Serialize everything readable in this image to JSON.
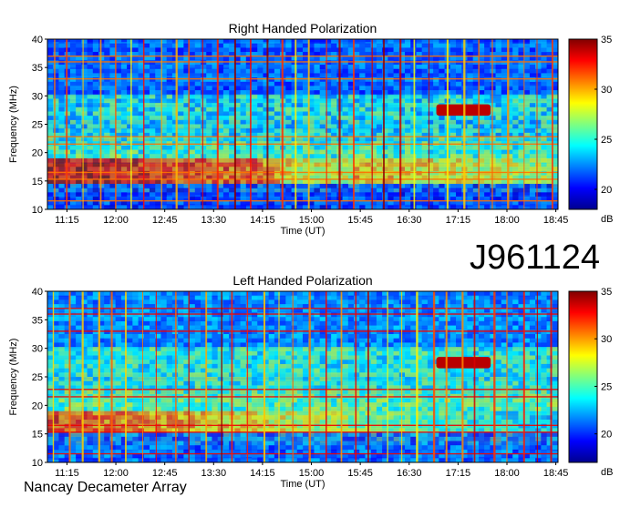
{
  "page": {
    "observation_id": "J961124",
    "instrument": "Nancay Decameter Array"
  },
  "chart_data": [
    {
      "type": "heatmap",
      "title": "Right Handed Polarization",
      "xlabel": "Time (UT)",
      "ylabel": "Frequency (MHz)",
      "x_ticks": [
        "11:15",
        "12:00",
        "12:45",
        "13:30",
        "14:15",
        "15:00",
        "15:45",
        "16:30",
        "17:15",
        "18:00",
        "18:45"
      ],
      "y_ticks": [
        10,
        15,
        20,
        25,
        30,
        35,
        40
      ],
      "ylim": [
        10,
        40
      ],
      "colorbar": {
        "label": "dB",
        "ticks": [
          20,
          25,
          30,
          35
        ],
        "range": [
          18,
          35
        ]
      },
      "features": [
        {
          "type": "band",
          "freq_low": 14.5,
          "freq_high": 19,
          "level": 34
        },
        {
          "type": "burst",
          "time_start": "16:55",
          "time_end": "17:45",
          "freq_low": 26.5,
          "freq_high": 28.5,
          "level": 34
        }
      ]
    },
    {
      "type": "heatmap",
      "title": "Left Handed Polarization",
      "xlabel": "Time (UT)",
      "ylabel": "Frequency (MHz)",
      "x_ticks": [
        "11:15",
        "12:00",
        "12:45",
        "13:30",
        "14:15",
        "15:00",
        "15:45",
        "16:30",
        "17:15",
        "18:00",
        "18:45"
      ],
      "y_ticks": [
        10,
        15,
        20,
        25,
        30,
        35,
        40
      ],
      "ylim": [
        10,
        40
      ],
      "colorbar": {
        "label": "dB",
        "ticks": [
          20,
          25,
          30,
          35
        ],
        "range": [
          17,
          35
        ]
      },
      "features": [
        {
          "type": "band",
          "freq_low": 15.5,
          "freq_high": 19,
          "level": 32
        },
        {
          "type": "burst",
          "time_start": "16:55",
          "time_end": "17:45",
          "freq_low": 26.5,
          "freq_high": 28.5,
          "level": 34
        }
      ]
    }
  ]
}
